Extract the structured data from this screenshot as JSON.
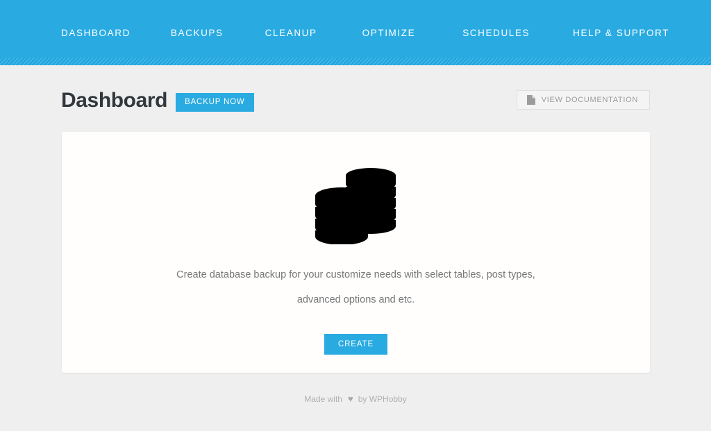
{
  "header": {
    "background_color": "#29abe2",
    "nav_items": [
      {
        "label": "DASHBOARD"
      },
      {
        "label": "BACKUPS"
      },
      {
        "label": "CLEANUP"
      },
      {
        "label": "OPTIMIZE"
      },
      {
        "label": "SCHEDULES"
      },
      {
        "label": "HELP & SUPPORT"
      }
    ]
  },
  "page": {
    "title": "Dashboard",
    "backup_now_label": "BACKUP NOW",
    "documentation_label": "VIEW DOCUMENTATION",
    "documentation_icon": "document-icon",
    "accent_color": "#29abe2",
    "background_color": "#efefef"
  },
  "card": {
    "illustration_icon": "database-stack-icon",
    "description": "Create database backup for your customize needs with select tables, post types, advanced options and etc.",
    "create_label": "CREATE",
    "background_color": "#fffefd"
  },
  "footer": {
    "prefix": "Made with",
    "heart_icon": "heart-icon",
    "heart_glyph": "♥",
    "suffix": "by WPHobby"
  }
}
